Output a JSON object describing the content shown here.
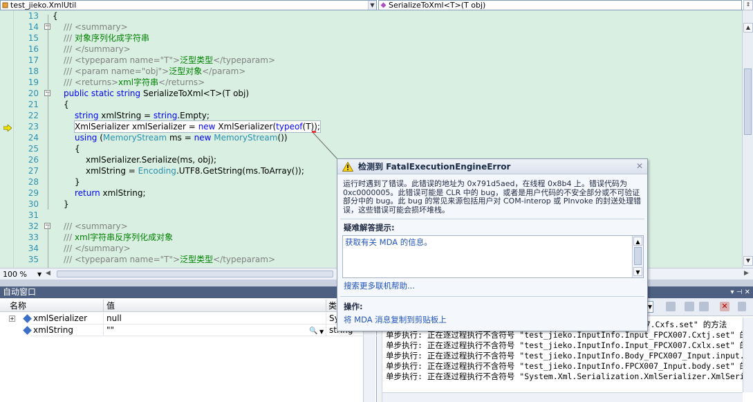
{
  "nav": {
    "left_combo": "test_jieko.XmlUtil",
    "right_combo": "SerializeToXml<T>(T obj)"
  },
  "editor": {
    "line_numbers": [
      "13",
      "14",
      "15",
      "16",
      "17",
      "18",
      "19",
      "20",
      "21",
      "22",
      "23",
      "24",
      "25",
      "26",
      "27",
      "28",
      "29",
      "30",
      "31",
      "32",
      "33",
      "34",
      "35"
    ],
    "lines": [
      [
        [
          "txt",
          "{"
        ]
      ],
      [
        [
          "c",
          "/// <summary>"
        ]
      ],
      [
        [
          "c",
          "/// "
        ],
        [
          "g",
          "对象序列化成字符串"
        ]
      ],
      [
        [
          "c",
          "/// </summary>"
        ]
      ],
      [
        [
          "c",
          "/// <typeparam name=\"T\">"
        ],
        [
          "g",
          "泛型类型"
        ],
        [
          "c",
          "</typeparam>"
        ]
      ],
      [
        [
          "c",
          "/// <param name=\"obj\">"
        ],
        [
          "g",
          "泛型对象"
        ],
        [
          "c",
          "</param>"
        ]
      ],
      [
        [
          "c",
          "/// <returns>"
        ],
        [
          "g",
          "xml字符串"
        ],
        [
          "c",
          "</returns>"
        ]
      ],
      [
        [
          "k",
          "public static string "
        ],
        [
          "txt",
          "SerializeToXml<T>(T obj)"
        ]
      ],
      [
        [
          "txt",
          "{"
        ]
      ],
      [
        [
          "k",
          "string "
        ],
        [
          "txt",
          "xmlString = "
        ],
        [
          "k",
          "string"
        ],
        [
          "txt",
          ".Empty;"
        ]
      ],
      [
        [
          "txt",
          "XmlSerializer xmlSerializer = "
        ],
        [
          "k",
          "new "
        ],
        [
          "txt",
          "XmlSerializer("
        ],
        [
          "k",
          "typeof"
        ],
        [
          "txt",
          "(T));"
        ]
      ],
      [
        [
          "k",
          "using "
        ],
        [
          "txt",
          "("
        ],
        [
          "t",
          "MemoryStream"
        ],
        [
          "txt",
          " ms = "
        ],
        [
          "k",
          "new "
        ],
        [
          "t",
          "MemoryStream"
        ],
        [
          "txt",
          "())"
        ]
      ],
      [
        [
          "txt",
          "{"
        ]
      ],
      [
        [
          "txt",
          "xmlSerializer.Serialize(ms, obj);"
        ]
      ],
      [
        [
          "txt",
          "xmlString = "
        ],
        [
          "t",
          "Encoding"
        ],
        [
          "txt",
          ".UTF8.GetString(ms.ToArray());"
        ]
      ],
      [
        [
          "txt",
          "}"
        ]
      ],
      [
        [
          "k",
          "return "
        ],
        [
          "txt",
          "xmlString;"
        ]
      ],
      [
        [
          "txt",
          "}"
        ]
      ],
      [
        [
          "txt",
          ""
        ]
      ],
      [
        [
          "c",
          "/// <summary>"
        ]
      ],
      [
        [
          "c",
          "/// "
        ],
        [
          "g",
          "xml字符串反序列化成对象"
        ]
      ],
      [
        [
          "c",
          "/// </summary>"
        ]
      ],
      [
        [
          "c",
          "/// <typeparam name=\"T\">"
        ],
        [
          "g",
          "泛型类型"
        ],
        [
          "c",
          "</typeparam>"
        ]
      ]
    ],
    "zoom": "100 %"
  },
  "autos": {
    "title": "自动窗口",
    "col_name": "名称",
    "col_value": "值",
    "col_type": "类",
    "rows": [
      {
        "name": "xmlSerializer",
        "value": "null",
        "type": "Sy"
      },
      {
        "name": "xmlString",
        "value": "\"\"",
        "type": "string"
      }
    ]
  },
  "output": {
    "lines": [
      "CX007.Cxfs.set\" 的方法",
      "单步执行: 正在逐过程执行不含符号 \"test_jieko.InputInfo.Input_FPCX007.Cxtj.set\" 的方法",
      "单步执行: 正在逐过程执行不含符号 \"test_jieko.InputInfo.Input_FPCX007.Cxlx.set\" 的方法",
      "单步执行: 正在逐过程执行不含符号 \"test_jieko.InputInfo.Body_FPCX007_Input.input.set\" 的",
      "单步执行: 正在逐过程执行不含符号 \"test_jieko.InputInfo.FPCX007_Input.body.set\" 的方法",
      "单步执行: 正在逐过程执行不含符号 \"System.Xml.Serialization.XmlSerializer.XmlSerializer"
    ]
  },
  "popup": {
    "title": "检测到 FatalExecutionEngineError",
    "message": "运行时遇到了错误。此错误的地址为 0x791d5aed，在线程 0x8b4 上。错误代码为 0xc0000005。此错误可能是 CLR 中的 bug，或者是用户代码的不安全部分或不可验证部分中的 bug。此 bug 的常见来源包括用户对 COM-interop 或 PInvoke 的封送处理错误，这些错误可能会损坏堆栈。",
    "tips_heading": "疑难解答提示:",
    "tip_link": "获取有关 MDA 的信息。",
    "more_help": "搜索更多联机帮助...",
    "actions_heading": "操作:",
    "copy_link": "将 MDA 消息复制到剪贴板上"
  }
}
